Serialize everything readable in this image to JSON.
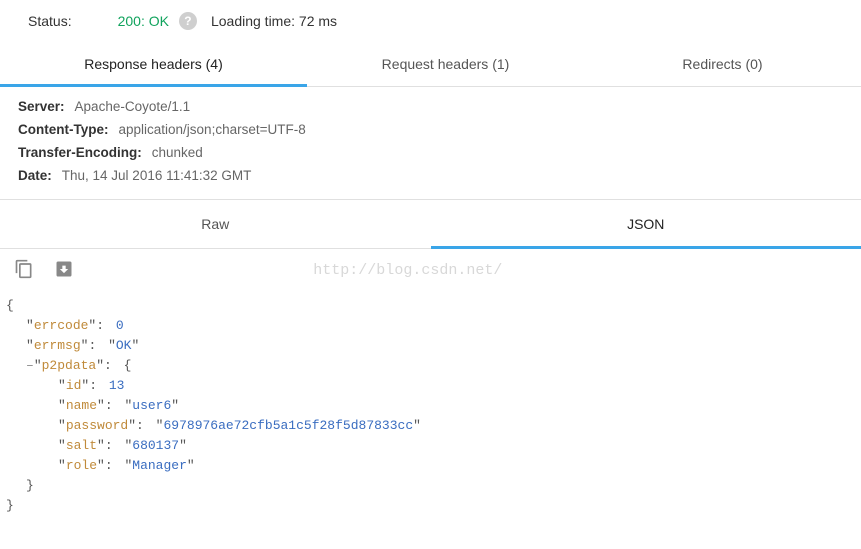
{
  "status": {
    "label": "Status:",
    "code_text": "200: OK",
    "loading_label": "Loading time: 72 ms"
  },
  "header_tabs": [
    {
      "label": "Response headers (4)",
      "active": true
    },
    {
      "label": "Request headers (1)",
      "active": false
    },
    {
      "label": "Redirects (0)",
      "active": false
    }
  ],
  "headers": [
    {
      "key": "Server",
      "value": "Apache-Coyote/1.1"
    },
    {
      "key": "Content-Type",
      "value": "application/json;charset=UTF-8"
    },
    {
      "key": "Transfer-Encoding",
      "value": "chunked"
    },
    {
      "key": "Date",
      "value": "Thu, 14 Jul 2016 11:41:32 GMT"
    }
  ],
  "body_tabs": [
    {
      "label": "Raw",
      "active": false
    },
    {
      "label": "JSON",
      "active": true
    }
  ],
  "watermark": "http://blog.csdn.net/",
  "json_body": {
    "errcode": 0,
    "errmsg": "OK",
    "p2pdata": {
      "id": 13,
      "name": "user6",
      "password": "6978976ae72cfb5a1c5f28f5d87833cc",
      "salt": "680137",
      "role": "Manager"
    }
  },
  "collapse_symbol": "–"
}
